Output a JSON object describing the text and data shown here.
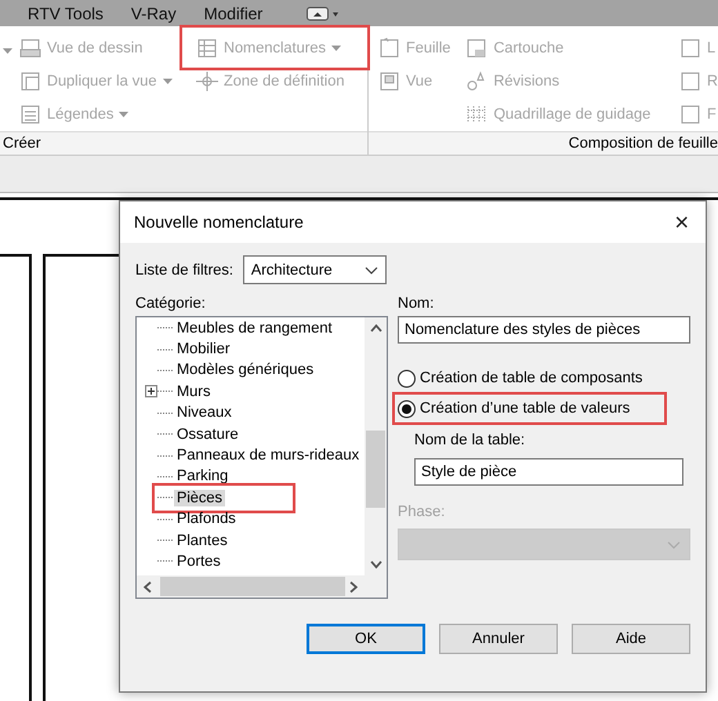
{
  "menu_bar": {
    "tabs": [
      {
        "label": "RTV Tools"
      },
      {
        "label": "V-Ray"
      },
      {
        "label": "Modifier"
      }
    ]
  },
  "ribbon": {
    "panels": [
      {
        "title": "Créer",
        "columns": [
          [
            {
              "label": "Vue de dessin",
              "dropdown": false,
              "disabled": true,
              "highlighted": false
            },
            {
              "label": "Dupliquer la vue",
              "dropdown": true,
              "disabled": true,
              "highlighted": false
            },
            {
              "label": "Légendes",
              "dropdown": true,
              "disabled": true,
              "highlighted": false
            }
          ],
          [
            {
              "label": "Nomenclatures",
              "dropdown": true,
              "disabled": true,
              "highlighted": true
            },
            {
              "label": "Zone de définition",
              "dropdown": false,
              "disabled": true,
              "highlighted": false
            }
          ]
        ]
      },
      {
        "title": "Composition de feuille",
        "columns": [
          [
            {
              "label": "Feuille",
              "dropdown": false,
              "disabled": true,
              "highlighted": false
            },
            {
              "label": "Vue",
              "dropdown": false,
              "disabled": true,
              "highlighted": false
            }
          ],
          [
            {
              "label": "Cartouche",
              "dropdown": false,
              "disabled": true,
              "highlighted": false
            },
            {
              "label": "Révisions",
              "dropdown": false,
              "disabled": true,
              "highlighted": false
            },
            {
              "label": "Quadrillage de guidage",
              "dropdown": false,
              "disabled": true,
              "highlighted": false
            }
          ],
          [
            {
              "label": "L",
              "dropdown": false,
              "disabled": true,
              "highlighted": false
            },
            {
              "label": "R",
              "dropdown": false,
              "disabled": true,
              "highlighted": false
            },
            {
              "label": "F",
              "dropdown": false,
              "disabled": true,
              "highlighted": false
            }
          ]
        ]
      }
    ]
  },
  "dialog": {
    "title": "Nouvelle nomenclature",
    "close": "×",
    "filter": {
      "label": "Liste de filtres:",
      "value": "Architecture"
    },
    "category": {
      "label": "Catégorie:",
      "items": [
        {
          "label": "Meubles de rangement",
          "expandable": false,
          "selected": false,
          "highlighted": false
        },
        {
          "label": "Mobilier",
          "expandable": false,
          "selected": false,
          "highlighted": false
        },
        {
          "label": "Modèles génériques",
          "expandable": false,
          "selected": false,
          "highlighted": false
        },
        {
          "label": "Murs",
          "expandable": true,
          "selected": false,
          "highlighted": false
        },
        {
          "label": "Niveaux",
          "expandable": false,
          "selected": false,
          "highlighted": false
        },
        {
          "label": "Ossature",
          "expandable": false,
          "selected": false,
          "highlighted": false
        },
        {
          "label": "Panneaux de murs-rideaux",
          "expandable": false,
          "selected": false,
          "highlighted": false
        },
        {
          "label": "Parking",
          "expandable": false,
          "selected": false,
          "highlighted": false
        },
        {
          "label": "Pièces",
          "expandable": false,
          "selected": true,
          "highlighted": true
        },
        {
          "label": "Plafonds",
          "expandable": false,
          "selected": false,
          "highlighted": false
        },
        {
          "label": "Plantes",
          "expandable": false,
          "selected": false,
          "highlighted": false
        },
        {
          "label": "Portes",
          "expandable": false,
          "selected": false,
          "highlighted": false
        }
      ]
    },
    "name": {
      "label": "Nom:",
      "value": "Nomenclature des styles de pièces"
    },
    "options": [
      {
        "label": "Création de table de composants",
        "selected": false,
        "highlighted": false
      },
      {
        "label": "Création d’une table de valeurs",
        "selected": true,
        "highlighted": true
      }
    ],
    "table_name": {
      "label": "Nom de la table:",
      "value": "Style de pièce"
    },
    "phase": {
      "label": "Phase:",
      "disabled": true
    },
    "buttons": [
      {
        "label": "OK",
        "default": true
      },
      {
        "label": "Annuler",
        "default": false
      },
      {
        "label": "Aide",
        "default": false
      }
    ]
  }
}
